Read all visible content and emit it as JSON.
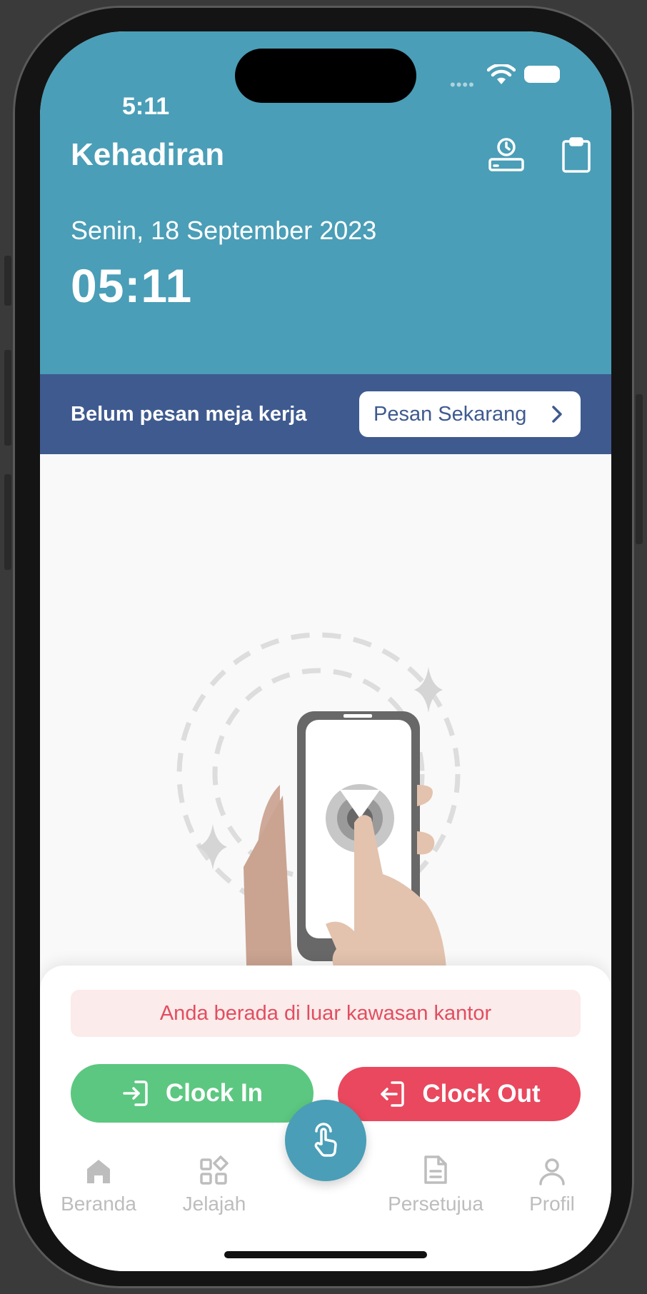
{
  "status_bar": {
    "time": "5:11"
  },
  "header": {
    "title": "Kehadiran",
    "date": "Senin, 18 September 2023",
    "clock": "05:11"
  },
  "banner": {
    "message": "Belum pesan meja kerja",
    "action_label": "Pesan Sekarang"
  },
  "attendance": {
    "warning": "Anda berada di luar kawasan kantor",
    "clock_in_label": "Clock In",
    "clock_out_label": "Clock Out"
  },
  "nav": {
    "items": [
      {
        "label": "Beranda",
        "icon": "home-icon"
      },
      {
        "label": "Jelajah",
        "icon": "explore-grid-icon"
      },
      {
        "label": "Persetujua",
        "icon": "document-icon"
      },
      {
        "label": "Profil",
        "icon": "profile-icon"
      }
    ],
    "center_icon": "tap-finger-icon"
  },
  "colors": {
    "header": "#4a9eb7",
    "banner": "#3f5a8f",
    "clock_in": "#5cc780",
    "clock_out": "#e9485e",
    "warning_text": "#e14e61"
  }
}
